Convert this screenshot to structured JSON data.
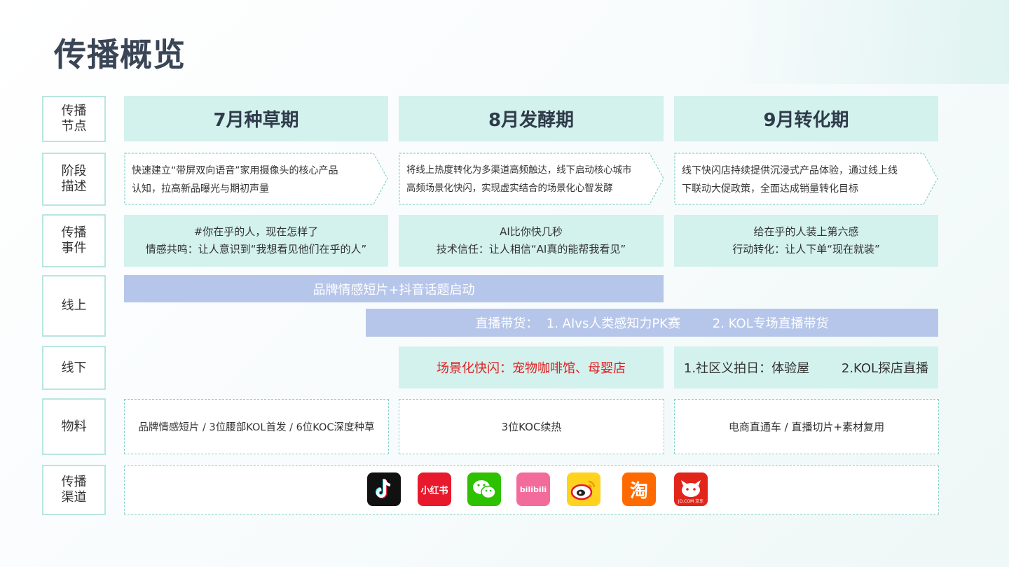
{
  "page_title": "传播概览",
  "row_labels": {
    "nodes": "传播\n节点",
    "stage": "阶段\n描述",
    "events": "传播\n事件",
    "online": "线上",
    "offline": "线下",
    "materials": "物料",
    "channels": "传播\n渠道"
  },
  "phases": [
    "7月种草期",
    "8月发酵期",
    "9月转化期"
  ],
  "descriptions": [
    [
      "快速建立“带屏双向语音”家用摄像头的核心产品",
      "认知，拉高新品曝光与期初声量"
    ],
    [
      "将线上热度转化为多渠道高频触达，线下启动核心城市",
      "高频场景化快闪，实现虚实结合的场景化心智发酵"
    ],
    [
      "线下快闪店持续提供沉浸式产品体验，通过线上线",
      "下联动大促政策，全面达成销量转化目标"
    ]
  ],
  "events": [
    [
      "#你在乎的人，现在怎样了",
      "情感共鸣：让人意识到“我想看见他们在乎的人”"
    ],
    [
      "AI比你快几秒",
      "技术信任：让人相信“AI真的能帮我看见”"
    ],
    [
      "给在乎的人装上第六感",
      "行动转化：让人下单“现在就装”"
    ]
  ],
  "online": {
    "bar1": "品牌情感短片+抖音话题启动",
    "bar2": "直播带货：  1. AIvs人类感知力PK赛        2. KOL专场直播带货"
  },
  "offline": {
    "aug": "场景化快闪：宠物咖啡馆、母婴店",
    "aug_color": "#e02020",
    "sep": "1.社区义拍日：体验屋        2.KOL探店直播"
  },
  "materials": [
    "品牌情感短片 / 3位腰部KOL首发 / 6位KOC深度种草",
    "3位KOC续热",
    "电商直通车 / 直播切片+素材复用"
  ],
  "channels": [
    {
      "icon": "douyin-icon",
      "label": "",
      "bg": "#111111"
    },
    {
      "icon": "xiaohongshu-icon",
      "label": "小红书",
      "bg": "#e8192c"
    },
    {
      "icon": "wechat-icon",
      "label": "",
      "bg": "#2dc100"
    },
    {
      "icon": "bilibili-icon",
      "label": "bilibili",
      "bg": "#f36b9b"
    },
    {
      "icon": "weibo-icon",
      "label": "",
      "bg": "#ffd21f"
    },
    {
      "icon": "taobao-icon",
      "label": "淘",
      "bg": "#ff6a00"
    },
    {
      "icon": "jd-icon",
      "label": "JD.COM 京东",
      "bg": "#e1251b"
    }
  ],
  "colors": {
    "accent_teal": "#d3f1ed",
    "bar_blue": "#b6c6ea",
    "dashed_border": "#86d3c6",
    "title": "#3a4556"
  }
}
